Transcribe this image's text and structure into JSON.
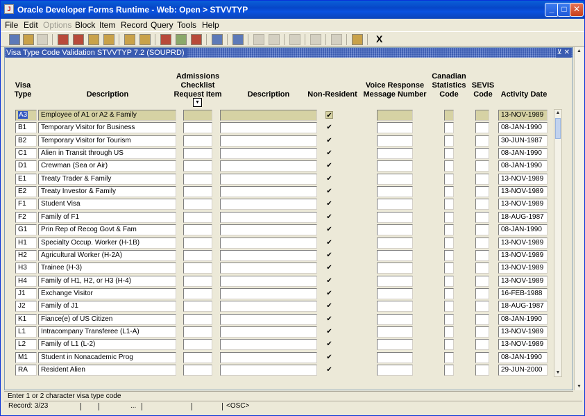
{
  "window": {
    "title": "Oracle Developer Forms Runtime - Web:  Open > STVVTYP",
    "app_icon": "oracle-forms-icon"
  },
  "menu": [
    "File",
    "Edit",
    "Options",
    "Block",
    "Item",
    "Record",
    "Query",
    "Tools",
    "Help"
  ],
  "menu_disabled": [
    "Options"
  ],
  "toolbar": {
    "exit_label": "X"
  },
  "form": {
    "title": "Visa Type Code Validation  STVVTYP  7.2  (SOUPRD)",
    "headers": {
      "visa_type": [
        "Visa",
        "Type"
      ],
      "description": [
        "Description"
      ],
      "admissions": [
        "Admissions",
        "Checklist",
        "Request Item"
      ],
      "description2": [
        "Description"
      ],
      "non_resident": [
        "Non-Resident"
      ],
      "voice_response": [
        "Voice Response",
        "Message Number"
      ],
      "canadian": [
        "Canadian",
        "Statistics",
        "Code"
      ],
      "sevis": [
        "SEVIS",
        "Code"
      ],
      "activity_date": [
        "Activity Date"
      ]
    },
    "current_row": 0,
    "rows": [
      {
        "code": "A3",
        "desc": "Employee of A1 or A2 & Family",
        "nonres": true,
        "date": "13-NOV-1989"
      },
      {
        "code": "B1",
        "desc": "Temporary Visitor for Business",
        "nonres": true,
        "date": "08-JAN-1990"
      },
      {
        "code": "B2",
        "desc": "Temporary Visitor for Tourism",
        "nonres": true,
        "date": "30-JUN-1987"
      },
      {
        "code": "C1",
        "desc": "Alien in Transit through US",
        "nonres": true,
        "date": "08-JAN-1990"
      },
      {
        "code": "D1",
        "desc": "Crewman (Sea or Air)",
        "nonres": true,
        "date": "08-JAN-1990"
      },
      {
        "code": "E1",
        "desc": "Treaty Trader & Family",
        "nonres": true,
        "date": "13-NOV-1989"
      },
      {
        "code": "E2",
        "desc": "Treaty Investor & Family",
        "nonres": true,
        "date": "13-NOV-1989"
      },
      {
        "code": "F1",
        "desc": "Student Visa",
        "nonres": true,
        "date": "13-NOV-1989"
      },
      {
        "code": "F2",
        "desc": "Family of F1",
        "nonres": true,
        "date": "18-AUG-1987"
      },
      {
        "code": "G1",
        "desc": "Prin Rep of Recog Govt & Fam",
        "nonres": true,
        "date": "08-JAN-1990"
      },
      {
        "code": "H1",
        "desc": "Specialty Occup. Worker (H-1B)",
        "nonres": true,
        "date": "13-NOV-1989"
      },
      {
        "code": "H2",
        "desc": "Agricultural Worker  (H-2A)",
        "nonres": true,
        "date": "13-NOV-1989"
      },
      {
        "code": "H3",
        "desc": "Trainee (H-3)",
        "nonres": true,
        "date": "13-NOV-1989"
      },
      {
        "code": "H4",
        "desc": "Family of H1, H2, or H3 (H-4)",
        "nonres": true,
        "date": "13-NOV-1989"
      },
      {
        "code": "J1",
        "desc": "Exchange Visitor",
        "nonres": true,
        "date": "16-FEB-1988"
      },
      {
        "code": "J2",
        "desc": "Family of J1",
        "nonres": true,
        "date": "18-AUG-1987"
      },
      {
        "code": "K1",
        "desc": "Fiance(e) of US Citizen",
        "nonres": true,
        "date": "08-JAN-1990"
      },
      {
        "code": "L1",
        "desc": "Intracompany Transferee (L1-A)",
        "nonres": true,
        "date": "13-NOV-1989"
      },
      {
        "code": "L2",
        "desc": "Family of L1 (L-2)",
        "nonres": true,
        "date": "13-NOV-1989"
      },
      {
        "code": "M1",
        "desc": "Student in Nonacademic Prog",
        "nonres": true,
        "date": "08-JAN-1990"
      },
      {
        "code": "RA",
        "desc": "Resident Alien",
        "nonres": true,
        "date": "29-JUN-2000"
      }
    ]
  },
  "status": {
    "hint": "Enter 1 or 2 character visa type code",
    "record": "Record: 3/23",
    "ellipsis": "...",
    "osc": "<OSC>"
  },
  "icons": {
    "checkmark": "✔",
    "dropdown": "▼",
    "scroll_up": "▲",
    "scroll_down": "▼",
    "minimize": "_",
    "maximize": "□",
    "close": "✕"
  }
}
